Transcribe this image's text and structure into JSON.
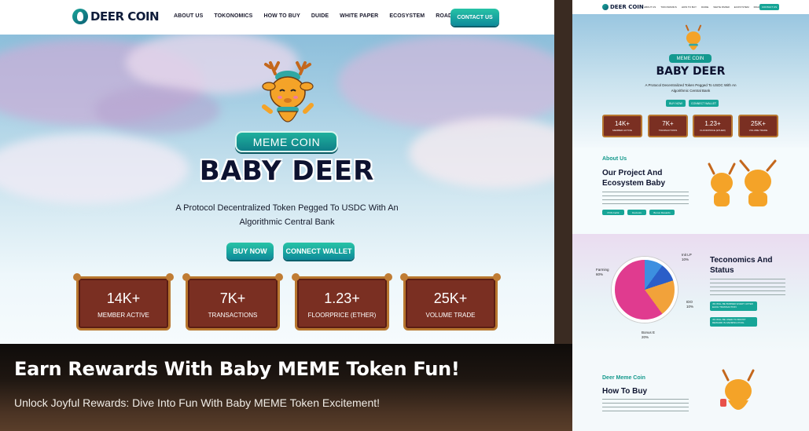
{
  "main": {
    "nav": {
      "logo_text": "DEER COIN",
      "menu": [
        "ABOUT US",
        "TOKONOMICS",
        "HOW TO BUY",
        "DUIDE",
        "WHITE PAPER",
        "ECOSYSTEM",
        "ROAD MAP"
      ],
      "contact_label": "CONTACT US"
    },
    "hero": {
      "pill": "MEME COIN",
      "title": "BABY DEER",
      "subtitle": "A Protocol Decentralized Token Pegged To USDC With An Algorithmic Central Bank",
      "buy_label": "BUY NOW",
      "wallet_label": "CONNECT WALLET"
    },
    "stats": [
      {
        "value": "14K+",
        "label": "MEMBER ACTIVE"
      },
      {
        "value": "7K+",
        "label": "TRANSACTIONS"
      },
      {
        "value": "1.23+",
        "label": "FLOORPRICE (ETHER)"
      },
      {
        "value": "25K+",
        "label": "VOLUME TRADE"
      }
    ]
  },
  "caption": {
    "headline": "Earn Rewards With Baby MEME Token Fun!",
    "tagline": "Unlock Joyful Rewards: Dive Into Fun With Baby MEME Token Excitement!"
  },
  "preview": {
    "logo_text": "DEER COIN",
    "menu": [
      "ABOUT US",
      "TOKONOMICS",
      "HOW TO BUY",
      "DUIDE",
      "WHITE PAPER",
      "ECOSYSTEM",
      "ROAD MAP"
    ],
    "contact_label": "CONTACT US",
    "hero": {
      "pill": "MEME COIN",
      "title": "BABY DEER",
      "subtitle": "A Protocol Decentralized Token Pegged To USDC With An Algorithmic Central Bank",
      "buy_label": "BUY NOW",
      "wallet_label": "CONNECT WALLET"
    },
    "stats": [
      {
        "value": "14K+",
        "label": "MEMBER ACTIVE"
      },
      {
        "value": "7K+",
        "label": "TRANSACTIONS"
      },
      {
        "value": "1.23+",
        "label": "FLOORPRICE (ETHER)"
      },
      {
        "value": "25K+",
        "label": "VOLUME TRADE"
      }
    ],
    "about": {
      "kicker": "About Us",
      "title_line1": "Our Project And",
      "title_line2": "Ecosystem Baby",
      "chips": [
        "POS Certik",
        "Dextools",
        "Bonus Rewards"
      ]
    },
    "tokenomics": {
      "title_line1": "Teconomics And",
      "title_line2": "Status",
      "labels": [
        {
          "name": "Farming",
          "pct": "60%"
        },
        {
          "name": "Init LP",
          "pct": "10%"
        },
        {
          "name": "IDO",
          "pct": "10%"
        },
        {
          "name": "Bonus E",
          "pct": "20%"
        }
      ],
      "chip1": "4% WILL BE BURNED EVERY AFTER EACH TRANSACTION",
      "chip2": "4% WILL BE USED TO BOOST REWARD IN FARMING POOL"
    },
    "howtobuy": {
      "kicker": "Deer Meme Coin",
      "title": "How To Buy"
    },
    "colors": {
      "accent": "#17a597",
      "stat_bg": "#7a2f22",
      "stat_border": "#b8772f",
      "title": "#0d1230"
    }
  }
}
